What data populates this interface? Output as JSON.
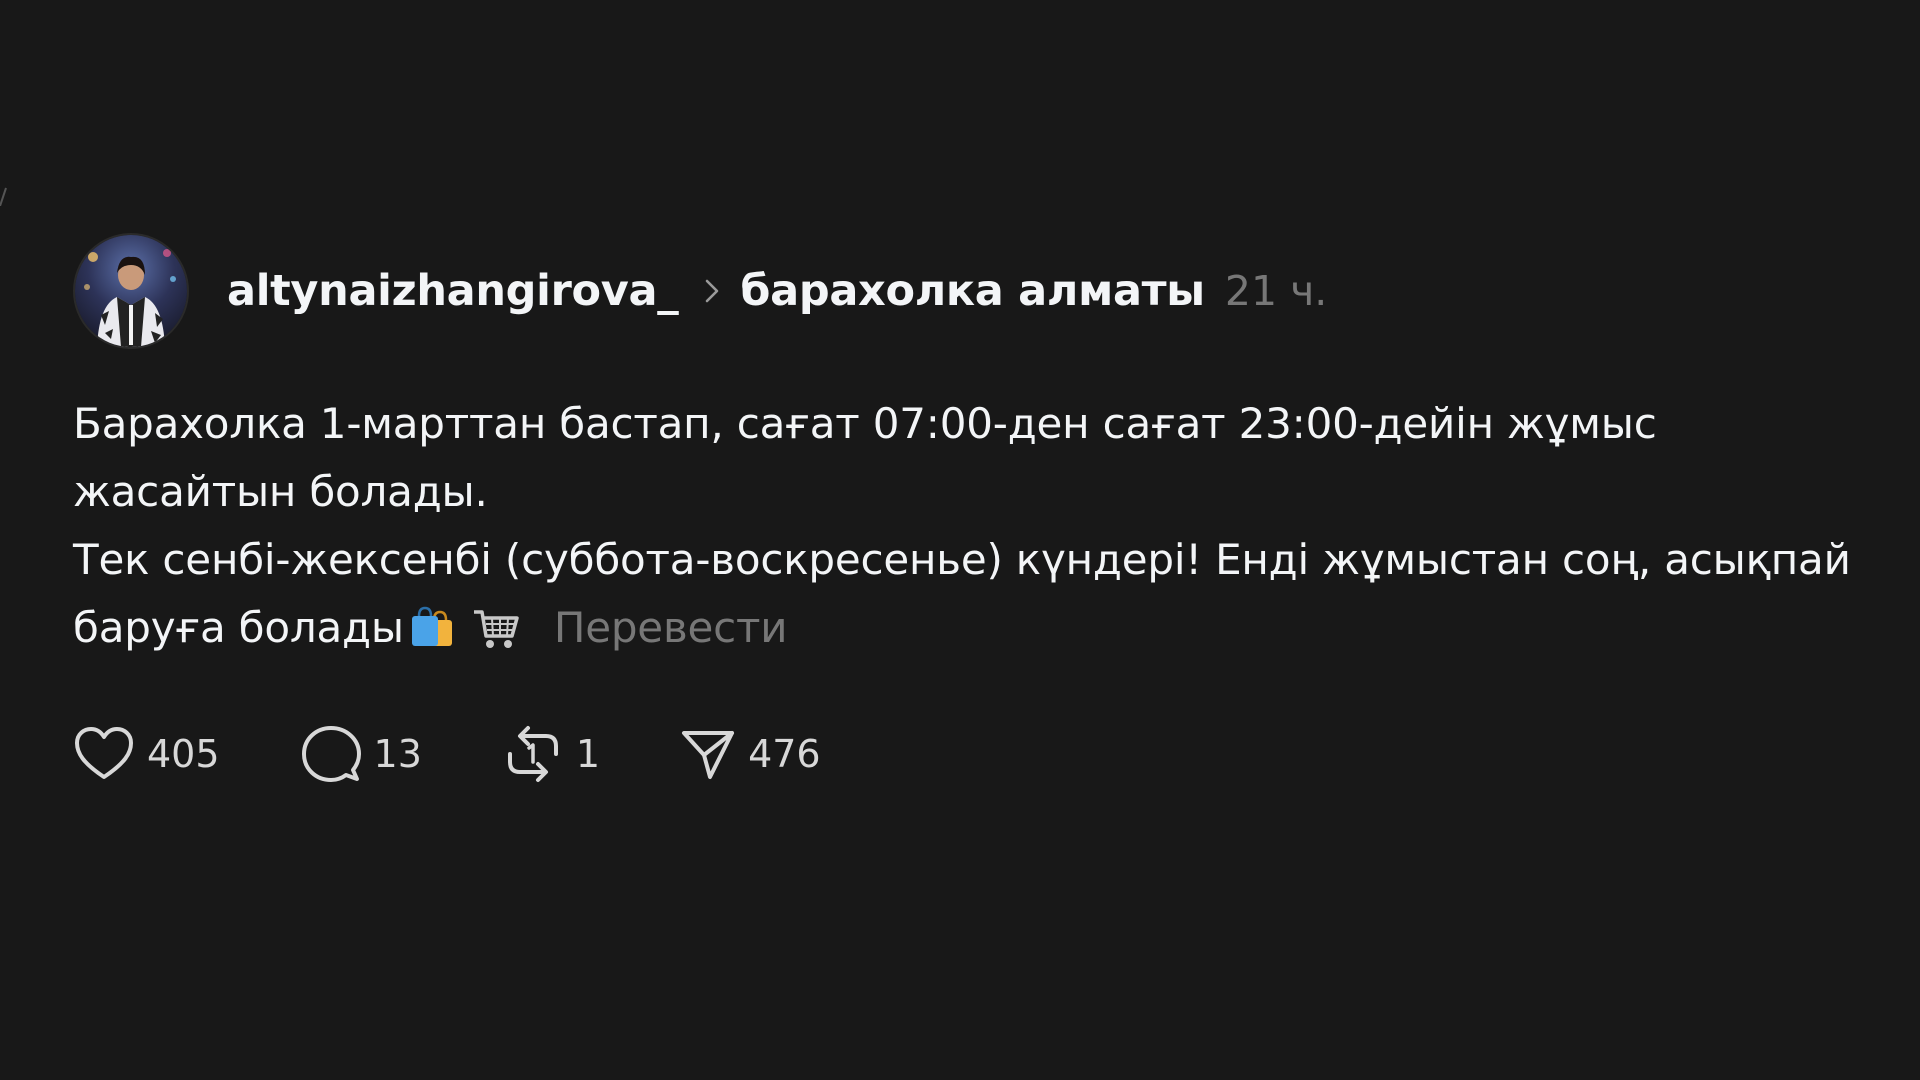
{
  "post": {
    "author": {
      "username": "altynaizhangirova_",
      "avatar_icon": "profile-photo"
    },
    "community": "барахолка алматы",
    "time": "21 ч.",
    "text_lines": [
      "Барахолка 1-марттан бастап, сағат 07:00-ден сағат 23:00-дейін жұмыс",
      "жасайтын болады.",
      "Тек сенбі-жексенбі (суббота-воскресенье) күндері! Енді жұмыстан соң, асықпай",
      "баруға болады"
    ],
    "emojis": [
      "shopping-bags-emoji",
      "shopping-cart-emoji"
    ],
    "translate_label": "Перевести",
    "actions": {
      "likes": "405",
      "comments": "13",
      "reposts": "1",
      "shares": "476"
    }
  },
  "colors": {
    "background": "#181818",
    "primary_text": "#f3f5f7",
    "secondary_text": "#777777"
  }
}
